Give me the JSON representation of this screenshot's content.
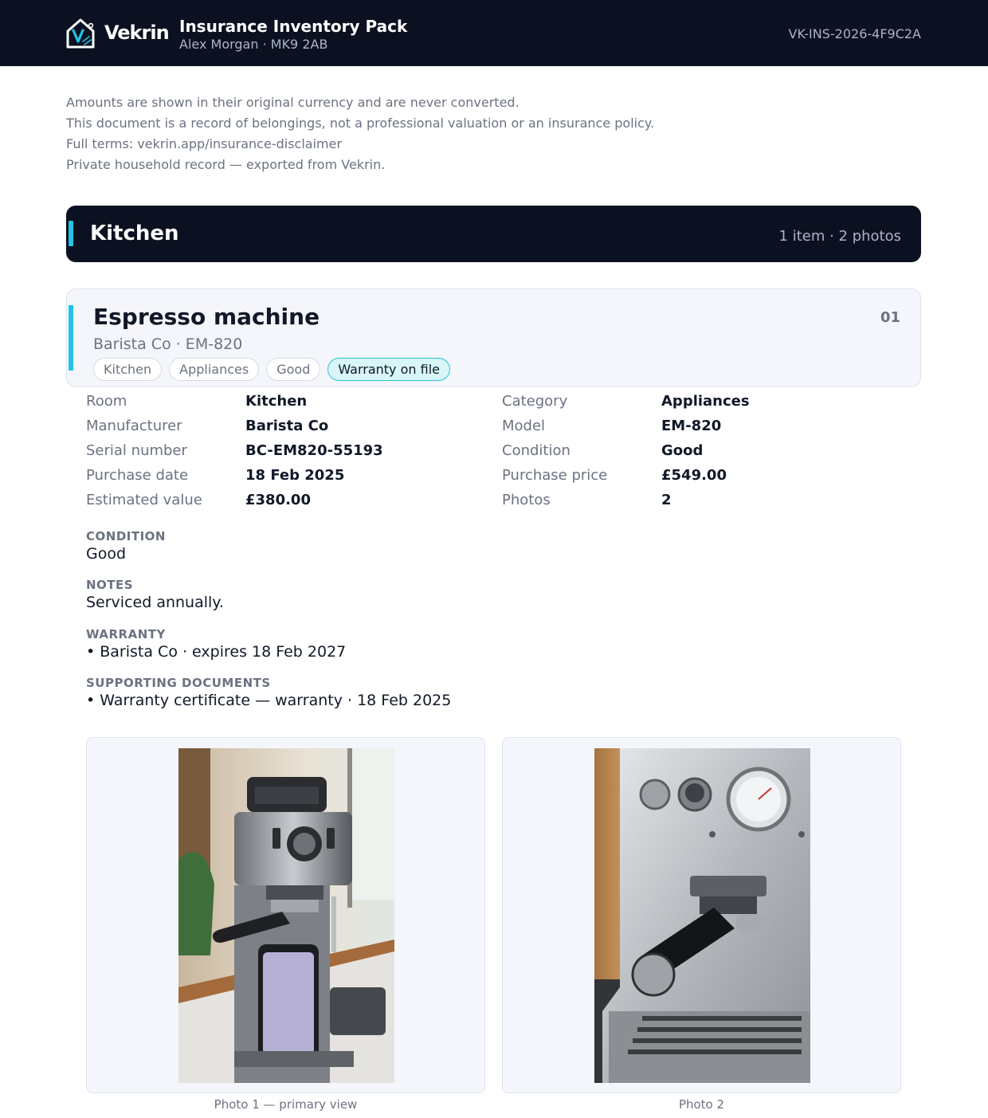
{
  "header": {
    "brand": "Vekrin",
    "title": "Insurance Inventory Pack",
    "subtitle": "Alex Morgan · MK9 2AB",
    "reference": "VK-INS-2026-4F9C2A"
  },
  "disclaimer": [
    "Amounts are shown in their original currency and are never converted.",
    "This document is a record of belongings, not a professional valuation or an insurance policy.",
    "Full terms: vekrin.app/insurance-disclaimer",
    "Private household record — exported from Vekrin."
  ],
  "room": {
    "name": "Kitchen",
    "count": "1 item · 2 photos"
  },
  "item": {
    "name": "Espresso machine",
    "subtitle": "Barista Co · EM-820",
    "number": "01",
    "tags": [
      "Kitchen",
      "Appliances",
      "Good",
      "Warranty on file"
    ],
    "details_left": [
      {
        "label": "Room",
        "value": "Kitchen"
      },
      {
        "label": "Manufacturer",
        "value": "Barista Co"
      },
      {
        "label": "Serial number",
        "value": "BC-EM820-55193"
      },
      {
        "label": "Purchase date",
        "value": "18 Feb 2025"
      },
      {
        "label": "Estimated value",
        "value": "£380.00"
      }
    ],
    "details_right": [
      {
        "label": "Category",
        "value": "Appliances"
      },
      {
        "label": "Model",
        "value": "EM-820"
      },
      {
        "label": "Condition",
        "value": "Good"
      },
      {
        "label": "Purchase price",
        "value": "£549.00"
      },
      {
        "label": "Photos",
        "value": "2"
      }
    ],
    "sections": [
      {
        "heading": "CONDITION",
        "body": "Good"
      },
      {
        "heading": "NOTES",
        "body": "Serviced annually."
      },
      {
        "heading": "WARRANTY",
        "body": "• Barista Co · expires 18 Feb 2027"
      },
      {
        "heading": "SUPPORTING DOCUMENTS",
        "body": "• Warranty certificate — warranty · 18 Feb 2025"
      }
    ],
    "photos": [
      {
        "caption": "Photo 1 — primary view"
      },
      {
        "caption": "Photo 2"
      }
    ]
  },
  "colors": {
    "header_bg": "#0b1120",
    "accent": "#22c3e6",
    "card_bg": "#f4f6fb"
  }
}
